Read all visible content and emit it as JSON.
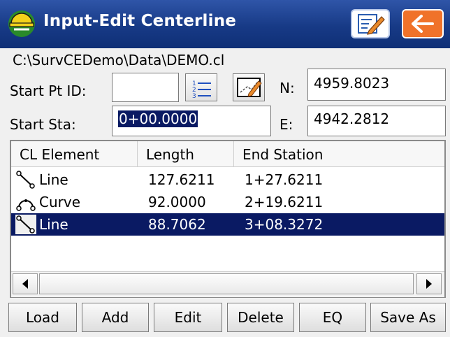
{
  "title": "Input-Edit Centerline",
  "file_path": "C:\\SurvCEDemo\\Data\\DEMO.cl",
  "form": {
    "start_pt_id_label": "Start Pt ID:",
    "start_pt_id_value": "",
    "start_sta_label": "Start Sta:",
    "start_sta_value": "0+00.0000",
    "n_label": "N:",
    "n_value": "4959.8023",
    "e_label": "E:",
    "e_value": "4942.2812"
  },
  "table": {
    "columns": [
      "CL Element",
      "Length",
      "End Station"
    ],
    "rows": [
      {
        "element": "Line",
        "length": "127.6211",
        "end_station": "1+27.6211",
        "icon": "line-element-icon"
      },
      {
        "element": "Curve",
        "length": "92.0000",
        "end_station": "2+19.6211",
        "icon": "curve-element-icon"
      },
      {
        "element": "Line",
        "length": "88.7062",
        "end_station": "3+08.3272",
        "icon": "line-element-icon",
        "selected": true
      }
    ]
  },
  "buttons": {
    "load": "Load",
    "add": "Add",
    "edit": "Edit",
    "delete": "Delete",
    "eq": "EQ",
    "save_as": "Save As"
  },
  "colors": {
    "title_bar": "#173a86",
    "selection": "#0a1a63",
    "back_button": "#f0722a"
  },
  "icons": [
    "app-helmet-icon",
    "edit-note-icon",
    "back-arrow-icon",
    "list-icon",
    "map-pick-icon",
    "scroll-left-icon",
    "scroll-right-icon"
  ]
}
